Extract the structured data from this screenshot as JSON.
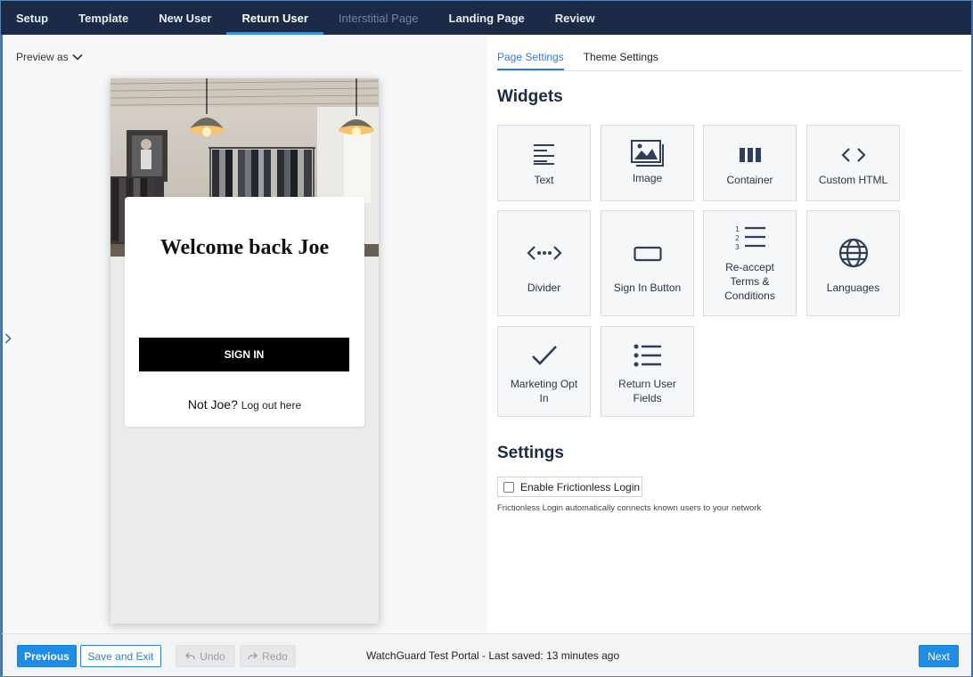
{
  "nav": {
    "tabs": [
      {
        "label": "Setup",
        "state": "normal"
      },
      {
        "label": "Template",
        "state": "normal"
      },
      {
        "label": "New User",
        "state": "normal"
      },
      {
        "label": "Return User",
        "state": "active"
      },
      {
        "label": "Interstitial Page",
        "state": "disabled"
      },
      {
        "label": "Landing Page",
        "state": "normal"
      },
      {
        "label": "Review",
        "state": "normal"
      }
    ]
  },
  "preview": {
    "preview_as_label": "Preview as",
    "welcome_title": "Welcome back Joe",
    "signin_label": "SIGN IN",
    "not_you_text": "Not Joe?",
    "logout_link": "Log out here"
  },
  "settings_tabs": {
    "page_settings": "Page Settings",
    "theme_settings": "Theme Settings"
  },
  "widgets": {
    "heading": "Widgets",
    "items": [
      {
        "label": "Text",
        "icon": "text-align-icon"
      },
      {
        "label": "Image",
        "icon": "image-icon"
      },
      {
        "label": "Container",
        "icon": "columns-icon"
      },
      {
        "label": "Custom HTML",
        "icon": "code-icon"
      },
      {
        "label": "Divider",
        "icon": "divider-icon"
      },
      {
        "label": "Sign In Button",
        "icon": "button-icon"
      },
      {
        "label": "Re-accept Terms & Conditions",
        "icon": "numbered-list-icon"
      },
      {
        "label": "Languages",
        "icon": "globe-icon"
      },
      {
        "label": "Marketing Opt In",
        "icon": "checkmark-icon"
      },
      {
        "label": "Return User Fields",
        "icon": "list-icon"
      }
    ]
  },
  "settings": {
    "heading": "Settings",
    "frictionless_label": "Enable Frictionless Login",
    "frictionless_checked": false,
    "help": "Frictionless Login automatically connects known users to your network"
  },
  "footer": {
    "previous": "Previous",
    "save_exit": "Save and Exit",
    "undo": "Undo",
    "redo": "Redo",
    "status": "WatchGuard Test Portal - Last saved: 13 minutes ago",
    "next": "Next"
  },
  "colors": {
    "nav_bg": "#1b2a45",
    "accent": "#1f8ce6",
    "active_tab_underline": "#3b8ee8",
    "icon": "#2f3f5a"
  }
}
